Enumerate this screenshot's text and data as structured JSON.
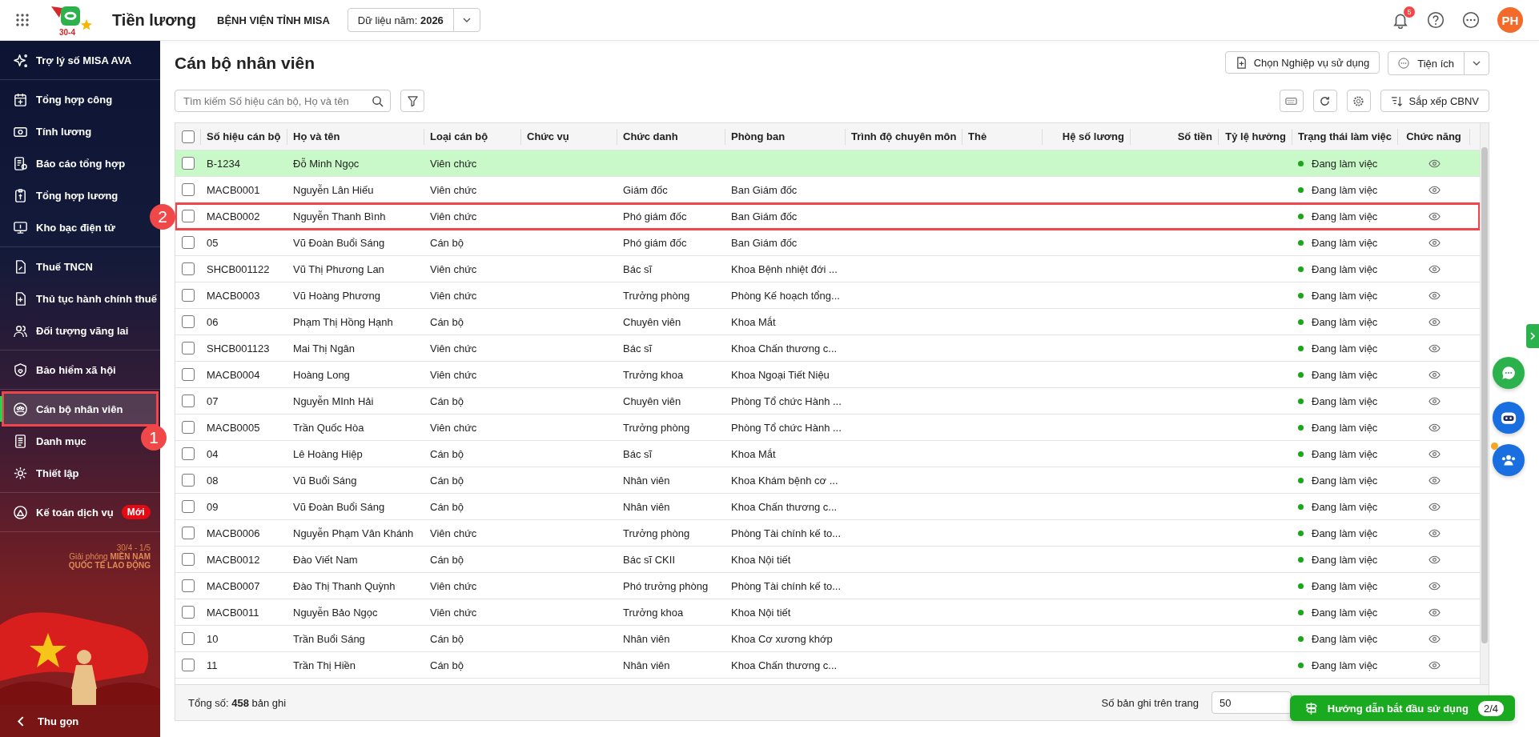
{
  "topbar": {
    "logo_text": "30-4",
    "app_name": "Tiền lương",
    "organization": "BỆNH VIỆN TỈNH MISA",
    "year_selector": {
      "label": "Dữ liệu năm:",
      "value": "2026"
    },
    "notification_count": "5",
    "avatar_initials": "PH"
  },
  "sidebar": {
    "groups": [
      [
        {
          "label": "Trợ lý số MISA AVA",
          "selected": false
        }
      ],
      [
        {
          "label": "Tổng hợp công",
          "selected": false
        },
        {
          "label": "Tính lương",
          "selected": false
        },
        {
          "label": "Báo cáo tổng hợp",
          "selected": false
        },
        {
          "label": "Tổng hợp lương",
          "selected": false
        },
        {
          "label": "Kho bạc điện tử",
          "selected": false
        }
      ],
      [
        {
          "label": "Thuế TNCN",
          "selected": false
        },
        {
          "label": "Thủ tục hành chính thuế",
          "selected": false
        },
        {
          "label": "Đối tượng vãng lai",
          "selected": false
        }
      ],
      [
        {
          "label": "Bảo hiểm xã hội",
          "selected": false
        }
      ],
      [
        {
          "label": "Cán bộ nhân viên",
          "selected": true,
          "callout": "1"
        },
        {
          "label": "Danh mục",
          "selected": false
        },
        {
          "label": "Thiết lập",
          "selected": false
        }
      ],
      [
        {
          "label": "Kế toán dịch vụ",
          "selected": false,
          "badge": "Mới"
        }
      ]
    ],
    "banner": {
      "dates": "30/4 - 1/5",
      "headline": "Giải phóng **MIỀN NAM**",
      "subline": "QUỐC TẾ LAO ĐỘNG"
    },
    "collapse_label": "Thu gọn"
  },
  "page": {
    "title": "Cán bộ nhân viên",
    "choose_button": "Chọn Nghiệp vụ sử dụng",
    "utilities_button": "Tiện ích",
    "search": {
      "placeholder": "Tìm kiếm Số hiệu cán bộ, Họ và tên"
    },
    "sort_button": "Sắp xếp CBNV"
  },
  "table": {
    "header_checked": false,
    "columns": [
      "Số hiệu cán bộ",
      "Họ và tên",
      "Loại cán bộ",
      "Chức vụ",
      "Chức danh",
      "Phòng ban",
      "Trình độ chuyên môn",
      "Thẻ",
      "Hệ số lương",
      "Số tiền",
      "Tỷ lệ hưởng",
      "Trạng thái làm việc",
      "Chức năng"
    ],
    "rows": [
      {
        "checked": false,
        "selected": true,
        "code": "B-1234",
        "name": "Đỗ Minh Ngọc",
        "staff_type": "Viên chức",
        "status": "Đang làm việc"
      },
      {
        "checked": false,
        "selected": false,
        "code": "MACB0001",
        "name": "Nguyễn Lân Hiếu",
        "staff_type": "Viên chức",
        "job_title": "Giám đốc",
        "department": "Ban Giám đốc",
        "status": "Đang làm việc"
      },
      {
        "checked": false,
        "selected": false,
        "code": "MACB0002",
        "name": "Nguyễn Thanh Bình",
        "staff_type": "Viên chức",
        "job_title": "Phó giám đốc",
        "department": "Ban Giám đốc",
        "status": "Đang làm việc",
        "callout": "2"
      },
      {
        "checked": false,
        "selected": false,
        "code": "05",
        "name": "Vũ Đoàn Buổi Sáng",
        "staff_type": "Cán bộ",
        "job_title": "Phó giám đốc",
        "department": "Ban Giám đốc",
        "status": "Đang làm việc"
      },
      {
        "checked": false,
        "selected": false,
        "code": "SHCB001122",
        "name": "Vũ Thị Phương Lan",
        "staff_type": "Viên chức",
        "job_title": "Bác sĩ",
        "department": "Khoa Bệnh nhiệt đới ...",
        "status": "Đang làm việc"
      },
      {
        "checked": false,
        "selected": false,
        "code": "MACB0003",
        "name": "Vũ Hoàng Phương",
        "staff_type": "Viên chức",
        "job_title": "Trưởng phòng",
        "department": "Phòng Kế hoạch tổng...",
        "status": "Đang làm việc"
      },
      {
        "checked": false,
        "selected": false,
        "code": "06",
        "name": "Phạm Thị Hồng Hạnh",
        "staff_type": "Cán bộ",
        "job_title": "Chuyên viên",
        "department": "Khoa Mắt",
        "status": "Đang làm việc"
      },
      {
        "checked": false,
        "selected": false,
        "code": "SHCB001123",
        "name": "Mai Thị Ngân",
        "staff_type": "Viên chức",
        "job_title": "Bác sĩ",
        "department": "Khoa Chấn thương c...",
        "status": "Đang làm việc"
      },
      {
        "checked": false,
        "selected": false,
        "code": "MACB0004",
        "name": "Hoàng Long",
        "staff_type": "Viên chức",
        "job_title": "Trưởng khoa",
        "department": "Khoa Ngoại Tiết Niệu",
        "status": "Đang làm việc"
      },
      {
        "checked": false,
        "selected": false,
        "code": "07",
        "name": "Nguyễn MInh Hải",
        "staff_type": "Cán bộ",
        "job_title": "Chuyên viên",
        "department": "Phòng Tổ chức Hành ...",
        "status": "Đang làm việc"
      },
      {
        "checked": false,
        "selected": false,
        "code": "MACB0005",
        "name": "Trần Quốc Hòa",
        "staff_type": "Viên chức",
        "job_title": "Trưởng phòng",
        "department": "Phòng Tổ chức Hành ...",
        "status": "Đang làm việc"
      },
      {
        "checked": false,
        "selected": false,
        "code": "04",
        "name": "Lê Hoàng Hiệp",
        "staff_type": "Cán bộ",
        "job_title": "Bác sĩ",
        "department": "Khoa Mắt",
        "status": "Đang làm việc"
      },
      {
        "checked": false,
        "selected": false,
        "code": "08",
        "name": "Vũ Buổi Sáng",
        "staff_type": "Cán bộ",
        "job_title": "Nhân viên",
        "department": "Khoa Khám bệnh cơ ...",
        "status": "Đang làm việc"
      },
      {
        "checked": false,
        "selected": false,
        "code": "09",
        "name": "Vũ Đoàn Buổi Sáng",
        "staff_type": "Cán bộ",
        "job_title": "Nhân viên",
        "department": "Khoa Chấn thương c...",
        "status": "Đang làm việc"
      },
      {
        "checked": false,
        "selected": false,
        "code": "MACB0006",
        "name": "Nguyễn Phạm Vân Khánh",
        "staff_type": "Viên chức",
        "job_title": "Trưởng phòng",
        "department": "Phòng Tài chính kế to...",
        "status": "Đang làm việc"
      },
      {
        "checked": false,
        "selected": false,
        "code": "MACB0012",
        "name": "Đào Viết Nam",
        "staff_type": "Cán bộ",
        "job_title": "Bác sĩ CKII",
        "department": "Khoa Nội tiết",
        "status": "Đang làm việc"
      },
      {
        "checked": false,
        "selected": false,
        "code": "MACB0007",
        "name": "Đào Thị Thanh Quỳnh",
        "staff_type": "Viên chức",
        "job_title": "Phó trưởng phòng",
        "department": "Phòng Tài chính kế to...",
        "status": "Đang làm việc"
      },
      {
        "checked": false,
        "selected": false,
        "code": "MACB0011",
        "name": "Nguyễn Bảo Ngọc",
        "staff_type": "Viên chức",
        "job_title": "Trưởng khoa",
        "department": "Khoa Nội tiết",
        "status": "Đang làm việc"
      },
      {
        "checked": false,
        "selected": false,
        "code": "10",
        "name": "Trần Buổi Sáng",
        "staff_type": "Cán bộ",
        "job_title": "Nhân viên",
        "department": "Khoa Cơ xương khớp",
        "status": "Đang làm việc"
      },
      {
        "checked": false,
        "selected": false,
        "code": "11",
        "name": "Trần Thị Hiền",
        "staff_type": "Cán bộ",
        "job_title": "Nhân viên",
        "department": "Khoa Chấn thương c...",
        "status": "Đang làm việc"
      }
    ]
  },
  "footer": {
    "total_text": "Tổng số: **458** bản ghi",
    "page_size_label": "Số bản ghi trên trang",
    "page_size": "50"
  },
  "guide_button": {
    "label": "Hướng dẫn bắt đầu sử dụng",
    "progress": "2/4"
  }
}
